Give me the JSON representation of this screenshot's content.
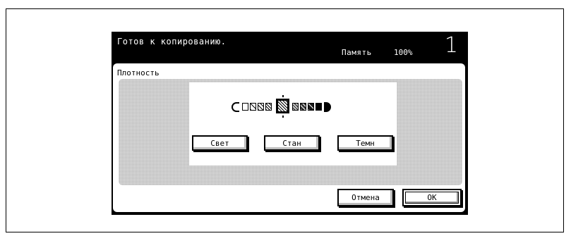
{
  "header": {
    "status": "Готов к копированию.",
    "memory_label": "Память",
    "memory_value": "100%",
    "copies": "1"
  },
  "panel": {
    "title": "Плотность",
    "density": {
      "levels": 9,
      "selected_level": 5
    },
    "buttons": {
      "light": "Свет",
      "standard": "Стан",
      "dark": "Темн"
    }
  },
  "footer": {
    "cancel": "Отмена",
    "ok": "OK"
  }
}
